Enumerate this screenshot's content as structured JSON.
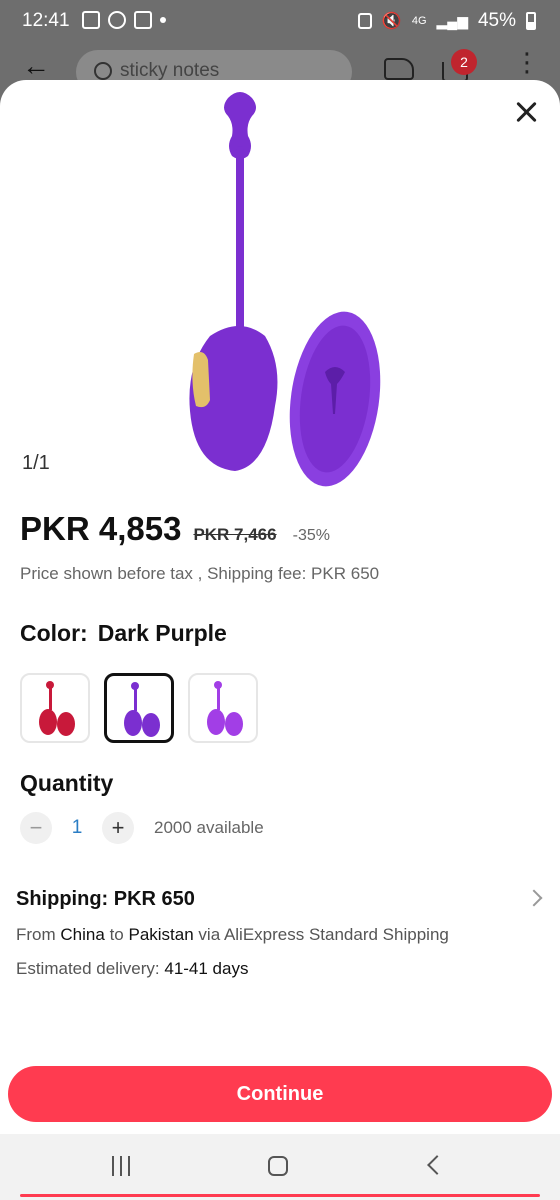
{
  "status_bar": {
    "time": "12:41",
    "network": "4G",
    "battery": "45%"
  },
  "header": {
    "search_placeholder": "sticky notes",
    "cart_count": "2"
  },
  "gallery": {
    "counter": "1/1"
  },
  "price": {
    "current": "PKR 4,853",
    "original": "PKR 7,466",
    "discount": "-35%",
    "note": "Price shown before tax , Shipping fee: PKR 650"
  },
  "color": {
    "label": "Color:",
    "value": "Dark Purple",
    "options": [
      "Red",
      "Dark Purple",
      "Purple"
    ],
    "swatch_colors": [
      "#c8193a",
      "#7b2fd0",
      "#a23ee6"
    ]
  },
  "quantity": {
    "label": "Quantity",
    "minus": "−",
    "value": "1",
    "plus": "+",
    "available": "2000 available"
  },
  "shipping": {
    "title": "Shipping: PKR 650",
    "from_prefix": "From",
    "from": "China",
    "to_prefix": "to",
    "to": "Pakistan",
    "via": "via AliExpress Standard Shipping",
    "delivery_prefix": "Estimated delivery:",
    "delivery": "41-41 days"
  },
  "cta": {
    "continue": "Continue"
  },
  "colors": {
    "accent": "#ff3b50",
    "product": "#7b2fd0"
  }
}
